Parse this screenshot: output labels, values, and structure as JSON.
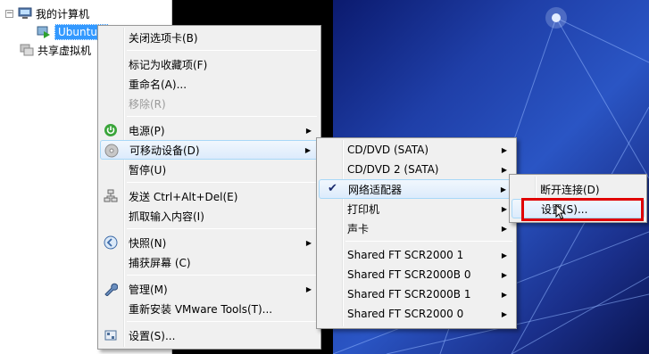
{
  "tree": {
    "root_label": "我的计算机",
    "vm_label": "UbuntuD",
    "shared_label": "共享虚拟机",
    "toggle": "−"
  },
  "context_menu": {
    "close_tab": "关闭选项卡(B)",
    "mark_favorite": "标记为收藏项(F)",
    "rename": "重命名(A)...",
    "remove": "移除(R)",
    "power": "电源(P)",
    "removable_devices": "可移动设备(D)",
    "pause": "暂停(U)",
    "send_cad": "发送 Ctrl+Alt+Del(E)",
    "grab_input": "抓取输入内容(I)",
    "snapshot": "快照(N)",
    "capture_screen": "捕获屏幕 (C)",
    "manage": "管理(M)",
    "reinstall_tools": "重新安装 VMware Tools(T)...",
    "settings": "设置(S)..."
  },
  "devices_menu": {
    "cd1": "CD/DVD (SATA)",
    "cd2": "CD/DVD 2 (SATA)",
    "network": "网络适配器",
    "printer": "打印机",
    "sound": "声卡",
    "sc1": "Shared FT SCR2000 1",
    "sc2": "Shared FT SCR2000B 0",
    "sc3": "Shared FT SCR2000B 1",
    "sc4": "Shared FT SCR2000 0"
  },
  "network_menu": {
    "disconnect": "断开连接(D)",
    "settings": "设置(S)..."
  },
  "colors": {
    "highlight_border": "#e00000",
    "selection": "#3399ff",
    "menu_bg": "#f0f0f0"
  }
}
